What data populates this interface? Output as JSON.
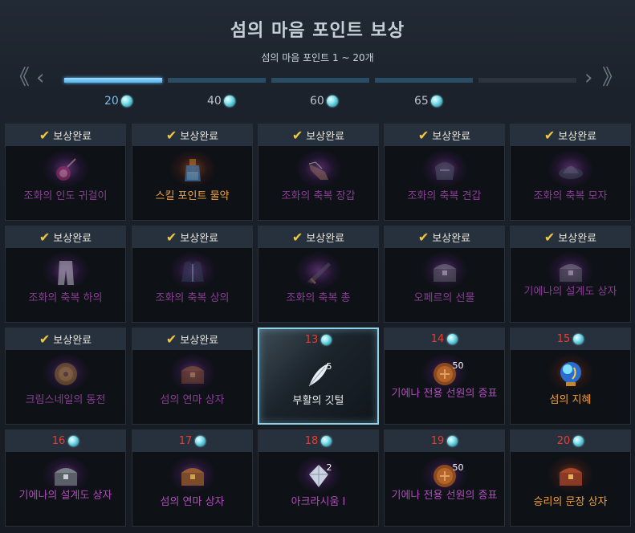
{
  "title": "섬의 마음 포인트 보상",
  "subtitle": "섬의 마음 포인트 1 ~ 20개",
  "nav": {
    "prev_first": "《",
    "prev": "‹",
    "next": "›",
    "next_last": "》"
  },
  "progress": {
    "filled_segments": 1,
    "total_segments": 5
  },
  "milestones": [
    {
      "value": "20",
      "icon": "island-heart-gem-icon",
      "reached": true
    },
    {
      "value": "40",
      "icon": "island-heart-gem-icon",
      "reached": false
    },
    {
      "value": "60",
      "icon": "island-heart-gem-icon",
      "reached": false
    },
    {
      "value": "65",
      "icon": "island-heart-gem-icon",
      "reached": false
    }
  ],
  "claimed_label": "보상완료",
  "rewards": [
    {
      "num": "",
      "claimed": true,
      "name": "조화의 인도 귀걸이",
      "icon": "earring-icon",
      "grade": "epic"
    },
    {
      "num": "",
      "claimed": true,
      "name": "스킬 포인트 물약",
      "icon": "potion-icon",
      "grade": "legendary"
    },
    {
      "num": "",
      "claimed": true,
      "name": "조화의 축복 장갑",
      "icon": "gloves-icon",
      "grade": "epic"
    },
    {
      "num": "",
      "claimed": true,
      "name": "조화의 축복 견갑",
      "icon": "shoulder-icon",
      "grade": "epic"
    },
    {
      "num": "",
      "claimed": true,
      "name": "조화의 축복 모자",
      "icon": "hat-icon",
      "grade": "epic"
    },
    {
      "num": "",
      "claimed": true,
      "name": "조화의 축복 하의",
      "icon": "pants-icon",
      "grade": "epic"
    },
    {
      "num": "",
      "claimed": true,
      "name": "조화의 축복 상의",
      "icon": "chest-armor-icon",
      "grade": "epic"
    },
    {
      "num": "",
      "claimed": true,
      "name": "조화의 축복 총",
      "icon": "gun-icon",
      "grade": "epic"
    },
    {
      "num": "",
      "claimed": true,
      "name": "오페르의 선물",
      "icon": "chest-icon",
      "grade": "epic"
    },
    {
      "num": "",
      "claimed": true,
      "name": "기에나의 설계도 상자",
      "icon": "chest-icon",
      "grade": "epic"
    },
    {
      "num": "",
      "claimed": true,
      "name": "크림스네일의 동전",
      "icon": "coin-icon",
      "grade": "epic"
    },
    {
      "num": "",
      "claimed": true,
      "name": "섬의 연마 상자",
      "icon": "wooden-chest-icon",
      "grade": "epic"
    },
    {
      "num": "13",
      "claimed": false,
      "name": "부활의 깃털",
      "icon": "feather-icon",
      "grade": "normal",
      "qty": "5",
      "active": true
    },
    {
      "num": "14",
      "claimed": false,
      "name": "기에나 전용 선원의 증표",
      "icon": "token-icon",
      "grade": "epic",
      "qty": "50"
    },
    {
      "num": "15",
      "claimed": false,
      "name": "섬의 지혜",
      "icon": "orb-icon",
      "grade": "legendary"
    },
    {
      "num": "16",
      "claimed": false,
      "name": "기에나의 설계도 상자",
      "icon": "chest-icon",
      "grade": "epic"
    },
    {
      "num": "17",
      "claimed": false,
      "name": "섬의 연마 상자",
      "icon": "wooden-chest-icon",
      "grade": "epic"
    },
    {
      "num": "18",
      "claimed": false,
      "name": "아크라시움 I",
      "icon": "crystal-icon",
      "grade": "epic",
      "qty": "2"
    },
    {
      "num": "19",
      "claimed": false,
      "name": "기에나 전용 선원의 증표",
      "icon": "token-icon",
      "grade": "epic",
      "qty": "50"
    },
    {
      "num": "20",
      "claimed": false,
      "name": "승리의 문장 상자",
      "icon": "red-chest-icon",
      "grade": "legendary"
    }
  ]
}
